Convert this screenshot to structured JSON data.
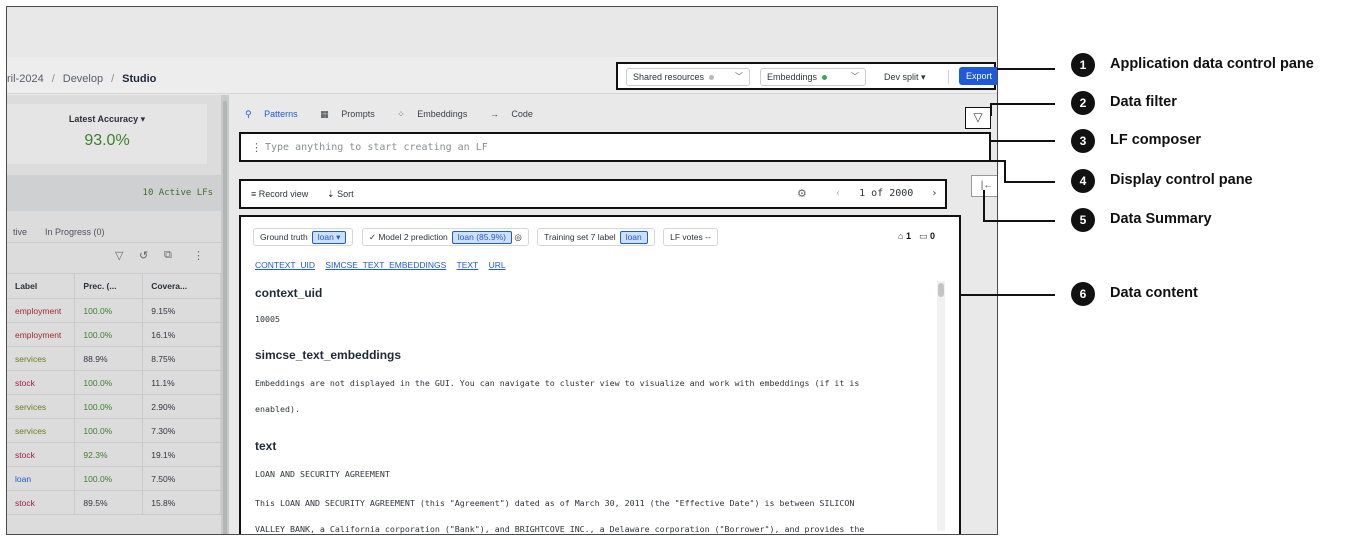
{
  "breadcrumb": {
    "project": "ril-2024",
    "section": "Develop",
    "current": "Studio"
  },
  "app_controls": {
    "shared_resources": "Shared resources",
    "embeddings": "Embeddings",
    "split": "Dev split",
    "export": "Export",
    "dot_colors": {
      "shared": "#b5b8be",
      "embeddings": "#3aa757"
    }
  },
  "left_panel": {
    "accuracy_label": "Latest Accuracy",
    "accuracy_value": "93.0%",
    "active_lfs": "10 Active LFs",
    "tab_active": "tive",
    "tab_progress": "In Progress (0)",
    "columns": [
      "Label",
      "Prec. (...",
      "Covera..."
    ],
    "rows": [
      {
        "label": "employment",
        "prec": "100.0%",
        "cov": "9.15%",
        "color": "#9c2b2b",
        "prec_color": "#3f7d2f"
      },
      {
        "label": "employment",
        "prec": "100.0%",
        "cov": "16.1%",
        "color": "#9c2b2b",
        "prec_color": "#3f7d2f"
      },
      {
        "label": "services",
        "prec": "88.9%",
        "cov": "8.75%",
        "color": "#6f7d1c",
        "prec_color": "#33363c"
      },
      {
        "label": "stock",
        "prec": "100.0%",
        "cov": "11.1%",
        "color": "#9c1f4a",
        "prec_color": "#3f7d2f"
      },
      {
        "label": "services",
        "prec": "100.0%",
        "cov": "2.90%",
        "color": "#6f7d1c",
        "prec_color": "#3f7d2f"
      },
      {
        "label": "services",
        "prec": "100.0%",
        "cov": "7.30%",
        "color": "#6f7d1c",
        "prec_color": "#3f7d2f"
      },
      {
        "label": "stock",
        "prec": "92.3%",
        "cov": "19.1%",
        "color": "#9c1f4a",
        "prec_color": "#3f7d2f"
      },
      {
        "label": "loan",
        "prec": "100.0%",
        "cov": "7.50%",
        "color": "#1f5ad9",
        "prec_color": "#3f7d2f"
      },
      {
        "label": "stock",
        "prec": "89.5%",
        "cov": "15.8%",
        "color": "#9c1f4a",
        "prec_color": "#33363c"
      }
    ]
  },
  "mode_tabs": {
    "patterns": "Patterns",
    "prompts": "Prompts",
    "embeddings": "Embeddings",
    "code": "Code"
  },
  "composer": {
    "placeholder": "Type anything to start creating an LF"
  },
  "display": {
    "record_view": "Record view",
    "sort": "Sort",
    "pager": "1 of 2000"
  },
  "record": {
    "ground_truth_label": "Ground truth",
    "ground_truth_value": "loan",
    "model_label": "Model 2 prediction",
    "model_value": "loan (85.9%)",
    "training_label": "Training set 7 label",
    "training_value": "loan",
    "lf_votes_label": "LF votes",
    "lf_votes_value": "--",
    "tag_count": "1",
    "comment_count": "0",
    "links": [
      "CONTEXT_UID",
      "SIMCSE_TEXT_EMBEDDINGS",
      "TEXT",
      "URL"
    ],
    "fields": [
      {
        "name": "context_uid",
        "lines": [
          "10005"
        ]
      },
      {
        "name": "simcse_text_embeddings",
        "lines": [
          "Embeddings are not displayed in the GUI. You can navigate to cluster view to visualize and work with embeddings (if it is",
          "enabled)."
        ]
      },
      {
        "name": "text",
        "lines": [
          "LOAN AND SECURITY AGREEMENT",
          "This LOAN AND SECURITY AGREEMENT (this \"Agreement\") dated as of March 30, 2011 (the \"Effective Date\") is between SILICON",
          "VALLEY BANK, a California corporation (\"Bank\"), and BRIGHTCOVE INC., a Delaware corporation (\"Borrower\"), and provides the"
        ]
      }
    ]
  },
  "annotations": [
    {
      "num": "1",
      "label": "Application data control pane"
    },
    {
      "num": "2",
      "label": "Data filter"
    },
    {
      "num": "3",
      "label": "LF composer"
    },
    {
      "num": "4",
      "label": "Display control pane"
    },
    {
      "num": "5",
      "label": "Data Summary"
    },
    {
      "num": "6",
      "label": "Data content"
    }
  ]
}
